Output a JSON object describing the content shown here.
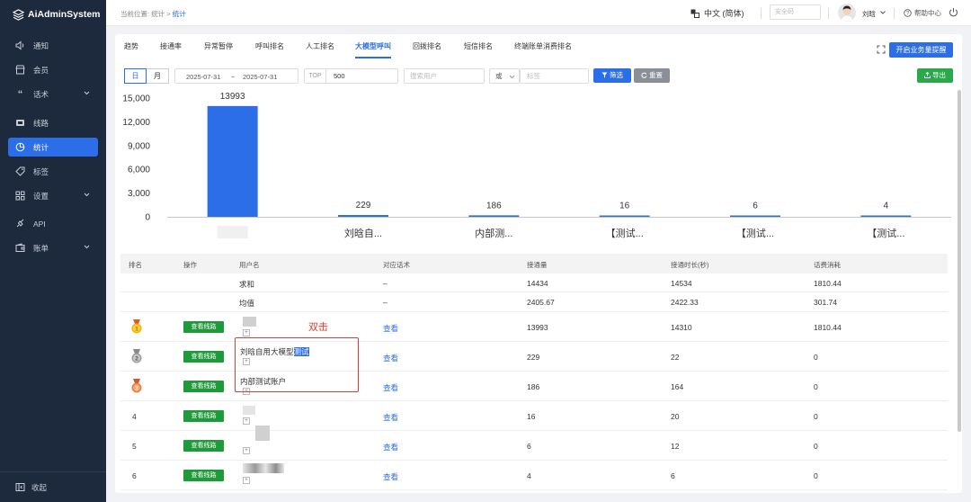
{
  "app": {
    "name": "AiAdminSystem"
  },
  "sidebar": {
    "items": [
      {
        "label": "通知",
        "icon": "speaker-icon"
      },
      {
        "label": "会员",
        "icon": "shop-icon"
      },
      {
        "label": "话术",
        "icon": "quote-icon",
        "expandable": true
      },
      {
        "label": "线路",
        "icon": "route-icon"
      },
      {
        "label": "统计",
        "icon": "chart-icon",
        "active": true
      },
      {
        "label": "标签",
        "icon": "tag-icon"
      },
      {
        "label": "设置",
        "icon": "grid-icon",
        "expandable": true
      },
      {
        "label": "API",
        "icon": "api-icon"
      },
      {
        "label": "账单",
        "icon": "wallet-icon",
        "expandable": true
      }
    ],
    "collapse_label": "收起"
  },
  "header": {
    "breadcrumb_prefix": "当前位置:",
    "breadcrumb_root": "统计",
    "breadcrumb_sep": ">",
    "breadcrumb_current": "统计",
    "language": "中文 (简体)",
    "security_code_placeholder": "安全码",
    "username": "刘晗",
    "help": "帮助中心"
  },
  "tabs": [
    "趋势",
    "接通率",
    "异常暂停",
    "呼叫排名",
    "人工排名",
    "大模型呼叫",
    "回拨排名",
    "短信排名",
    "终端账单消费排名"
  ],
  "active_tab": "大模型呼叫",
  "business_remind_button": "开启业务量提醒",
  "filters": {
    "day": "日",
    "month": "月",
    "date_start": "2025-07-31",
    "date_sep": "~",
    "date_end": "2025-07-31",
    "top_label": "TOP",
    "top_value": "500",
    "search_user_placeholder": "搜索用户",
    "or_value": "或",
    "tag_placeholder": "标签",
    "filter_button": "筛选",
    "reset_button": "重置",
    "export_button": "导出"
  },
  "chart_data": {
    "type": "bar",
    "categories": [
      "",
      "刘晗自...",
      "内部测...",
      "【测试...",
      "【测试...",
      "【测试..."
    ],
    "values": [
      13993,
      229,
      186,
      16,
      6,
      4
    ],
    "data_labels": [
      "13993",
      "229",
      "186",
      "16",
      "6",
      "4"
    ],
    "yticks": [
      "0",
      "3,000",
      "6,000",
      "9,000",
      "12,000",
      "15,000"
    ],
    "ylim": [
      0,
      15000
    ],
    "grid": false,
    "color": "#2c6ee8"
  },
  "table": {
    "columns": [
      "排名",
      "操作",
      "用户名",
      "对应话术",
      "接通量",
      "接通时长(秒)",
      "话费消耗"
    ],
    "summary_rows": [
      {
        "label": "求和",
        "script": "–",
        "connected": "14434",
        "duration": "14534",
        "cost": "1810.44"
      },
      {
        "label": "均值",
        "script": "–",
        "connected": "2405.67",
        "duration": "2422.33",
        "cost": "301.74"
      }
    ],
    "rows": [
      {
        "rank": "1",
        "medal": "gold",
        "action": "查看线路",
        "user": "",
        "script": "查看",
        "connected": "13993",
        "duration": "14310",
        "cost": "1810.44"
      },
      {
        "rank": "2",
        "medal": "silver",
        "action": "查看线路",
        "user_plain": "刘晗自用大模型",
        "user_selected": "测试",
        "script": "查看",
        "connected": "229",
        "duration": "22",
        "cost": "0"
      },
      {
        "rank": "3",
        "medal": "bronze",
        "action": "查看线路",
        "user": "内部测试账户",
        "script": "查看",
        "connected": "186",
        "duration": "164",
        "cost": "0"
      },
      {
        "rank": "4",
        "action": "查看线路",
        "user": "",
        "script": "查看",
        "connected": "16",
        "duration": "20",
        "cost": "0"
      },
      {
        "rank": "5",
        "action": "查看线路",
        "user": "",
        "script": "查看",
        "connected": "6",
        "duration": "12",
        "cost": "0"
      },
      {
        "rank": "6",
        "action": "查看线路",
        "user": "",
        "script": "查看",
        "connected": "4",
        "duration": "6",
        "cost": "0"
      }
    ],
    "expand_symbol": "+"
  },
  "annotation": {
    "text": "双击",
    "color": "#e03a2f"
  }
}
